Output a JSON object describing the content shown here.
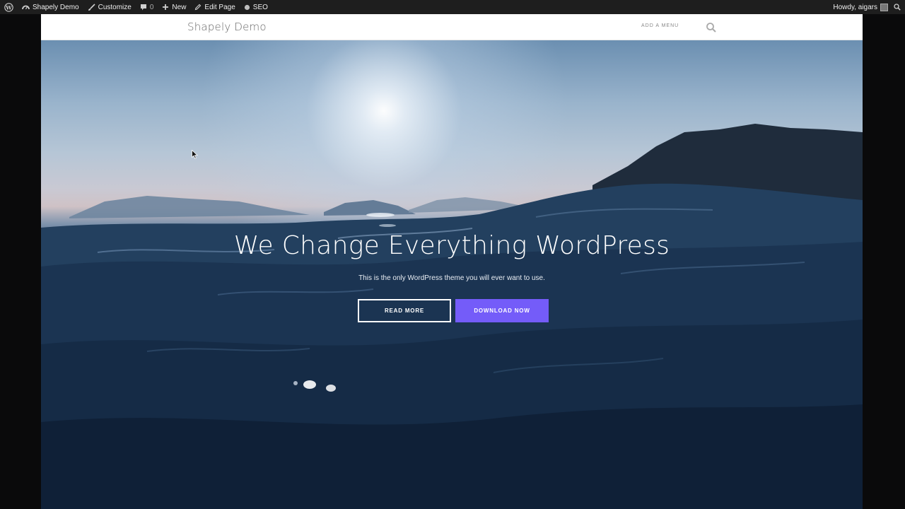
{
  "admin_bar": {
    "site_name": "Shapely Demo",
    "customize": "Customize",
    "comments_count": "0",
    "new": "New",
    "edit_page": "Edit Page",
    "seo": "SEO",
    "greeting": "Howdy, aigars"
  },
  "header": {
    "site_title": "Shapely Demo",
    "menu_link": "ADD A MENU"
  },
  "hero": {
    "title": "We Change Everything WordPress",
    "subtitle": "This is the only WordPress theme you will ever want to use.",
    "read_more": "READ MORE",
    "download": "DOWNLOAD NOW"
  },
  "colors": {
    "admin_bar": "#1e1e1e",
    "accent": "#745cf9",
    "header_bg": "#ffffff"
  },
  "icons": [
    "wordpress-icon",
    "dashboard-icon",
    "brush-icon",
    "comment-icon",
    "plus-icon",
    "pencil-icon",
    "seo-dot-icon",
    "search-icon",
    "mouse-cursor"
  ]
}
